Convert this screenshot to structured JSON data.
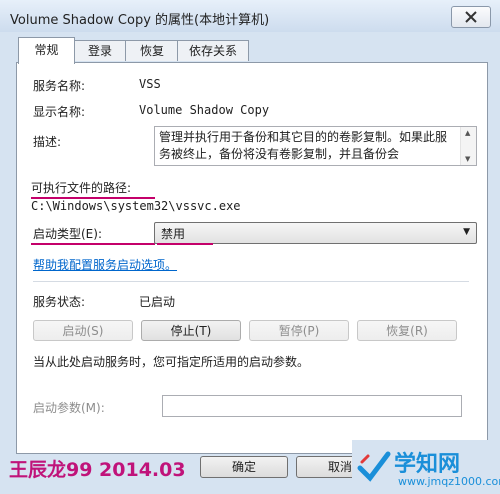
{
  "window": {
    "title": "Volume Shadow Copy 的属性(本地计算机)"
  },
  "tabs": [
    {
      "label": "常规"
    },
    {
      "label": "登录"
    },
    {
      "label": "恢复"
    },
    {
      "label": "依存关系"
    }
  ],
  "general": {
    "service_name_label": "服务名称:",
    "service_name": "VSS",
    "display_name_label": "显示名称:",
    "display_name": "Volume Shadow Copy",
    "description_label": "描述:",
    "description": "管理并执行用于备份和其它目的的卷影复制。如果此服务被终止，备份将没有卷影复制，并且备份会",
    "exe_path_label": "可执行文件的路径:",
    "exe_path": "C:\\Windows\\system32\\vssvc.exe",
    "startup_type_label": "启动类型(E):",
    "startup_type": "禁用",
    "help_link": "帮助我配置服务启动选项。",
    "status_label": "服务状态:",
    "status": "已启动",
    "buttons": {
      "start": "启动(S)",
      "stop": "停止(T)",
      "pause": "暂停(P)",
      "resume": "恢复(R)"
    },
    "hint": "当从此处启动服务时，您可指定所适用的启动参数。",
    "params_label": "启动参数(M):"
  },
  "footer": {
    "ok": "确定",
    "cancel": "取消"
  },
  "watermarks": {
    "author": "王辰龙99 2014.03",
    "logo": "学知网",
    "url": "www.jmqz1000.com"
  },
  "colors": {
    "annotation": "#c4006a",
    "link": "#0066cc",
    "logo": "#1a8fd9"
  }
}
